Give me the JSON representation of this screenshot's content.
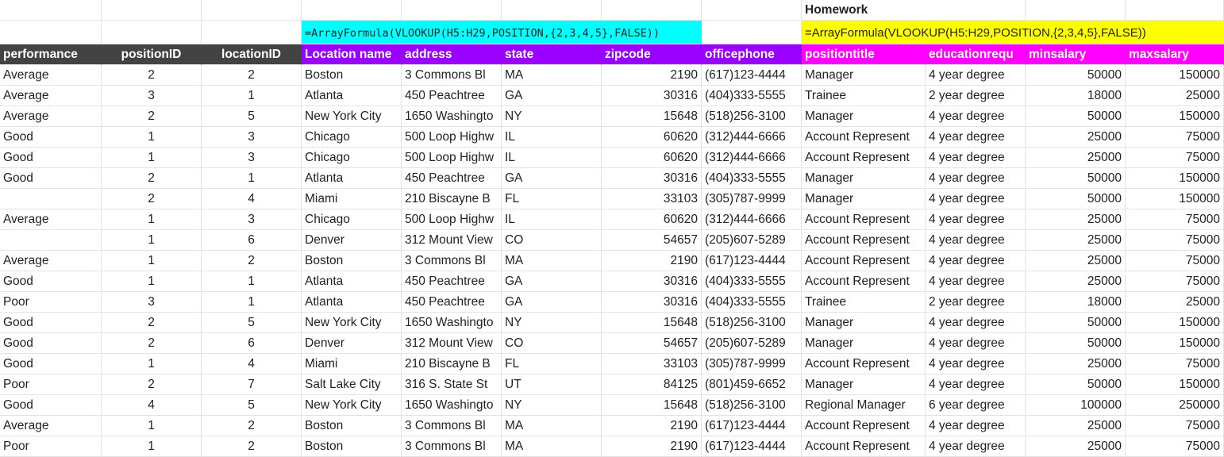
{
  "sheet": {
    "title_cell": "Homework",
    "formula_1": "=ArrayFormula(VLOOKUP(H5:H29,POSITION,{2,3,4,5},FALSE))",
    "formula_2": "=ArrayFormula(VLOOKUP(H5:H29,POSITION,{2,3,4,5},FALSE))",
    "colors": {
      "header_dark": "#434343",
      "header_purple": "#9900ff",
      "header_magenta": "#ff00ff",
      "formula_cyan": "#00ffff",
      "formula_yellow": "#ffff00"
    },
    "headers": [
      "performance",
      "positionID",
      "locationID",
      "Location name",
      "address",
      "state",
      "zipcode",
      "officephone",
      "positiontitle",
      "educationrequ",
      "minsalary",
      "maxsalary"
    ],
    "rows": [
      [
        "Average",
        "2",
        "2",
        "Boston",
        "3 Commons Bl",
        "MA",
        "2190",
        "(617)123-4444",
        "Manager",
        "4 year degree",
        "50000",
        "150000"
      ],
      [
        "Average",
        "3",
        "1",
        "Atlanta",
        "450 Peachtree",
        "GA",
        "30316",
        "(404)333-5555",
        "Trainee",
        "2 year degree",
        "18000",
        "25000"
      ],
      [
        "Average",
        "2",
        "5",
        "New York City",
        "1650 Washingto",
        "NY",
        "15648",
        "(518)256-3100",
        "Manager",
        "4 year degree",
        "50000",
        "150000"
      ],
      [
        "Good",
        "1",
        "3",
        "Chicago",
        "500 Loop Highw",
        "IL",
        "60620",
        "(312)444-6666",
        "Account Represent",
        "4 year degree",
        "25000",
        "75000"
      ],
      [
        "Good",
        "1",
        "3",
        "Chicago",
        "500 Loop Highw",
        "IL",
        "60620",
        "(312)444-6666",
        "Account Represent",
        "4 year degree",
        "25000",
        "75000"
      ],
      [
        "Good",
        "2",
        "1",
        "Atlanta",
        "450 Peachtree",
        "GA",
        "30316",
        "(404)333-5555",
        "Manager",
        "4 year degree",
        "50000",
        "150000"
      ],
      [
        "",
        "2",
        "4",
        "Miami",
        "210 Biscayne B",
        "FL",
        "33103",
        "(305)787-9999",
        "Manager",
        "4 year degree",
        "50000",
        "150000"
      ],
      [
        "Average",
        "1",
        "3",
        "Chicago",
        "500 Loop Highw",
        "IL",
        "60620",
        "(312)444-6666",
        "Account Represent",
        "4 year degree",
        "25000",
        "75000"
      ],
      [
        "",
        "1",
        "6",
        "Denver",
        "312 Mount View",
        "CO",
        "54657",
        "(205)607-5289",
        "Account Represent",
        "4 year degree",
        "25000",
        "75000"
      ],
      [
        "Average",
        "1",
        "2",
        "Boston",
        "3 Commons Bl",
        "MA",
        "2190",
        "(617)123-4444",
        "Account Represent",
        "4 year degree",
        "25000",
        "75000"
      ],
      [
        "Good",
        "1",
        "1",
        "Atlanta",
        "450 Peachtree",
        "GA",
        "30316",
        "(404)333-5555",
        "Account Represent",
        "4 year degree",
        "25000",
        "75000"
      ],
      [
        "Poor",
        "3",
        "1",
        "Atlanta",
        "450 Peachtree",
        "GA",
        "30316",
        "(404)333-5555",
        "Trainee",
        "2 year degree",
        "18000",
        "25000"
      ],
      [
        "Good",
        "2",
        "5",
        "New York City",
        "1650 Washingto",
        "NY",
        "15648",
        "(518)256-3100",
        "Manager",
        "4 year degree",
        "50000",
        "150000"
      ],
      [
        "Good",
        "2",
        "6",
        "Denver",
        "312 Mount View",
        "CO",
        "54657",
        "(205)607-5289",
        "Manager",
        "4 year degree",
        "50000",
        "150000"
      ],
      [
        "Good",
        "1",
        "4",
        "Miami",
        "210 Biscayne B",
        "FL",
        "33103",
        "(305)787-9999",
        "Account Represent",
        "4 year degree",
        "25000",
        "75000"
      ],
      [
        "Poor",
        "2",
        "7",
        "Salt Lake City",
        "316 S. State St",
        "UT",
        "84125",
        "(801)459-6652",
        "Manager",
        "4 year degree",
        "50000",
        "150000"
      ],
      [
        "Good",
        "4",
        "5",
        "New York City",
        "1650 Washingto",
        "NY",
        "15648",
        "(518)256-3100",
        "Regional Manager",
        "6 year degree",
        "100000",
        "250000"
      ],
      [
        "Average",
        "1",
        "2",
        "Boston",
        "3 Commons Bl",
        "MA",
        "2190",
        "(617)123-4444",
        "Account Represent",
        "4 year degree",
        "25000",
        "75000"
      ],
      [
        "Poor",
        "1",
        "2",
        "Boston",
        "3 Commons Bl",
        "MA",
        "2190",
        "(617)123-4444",
        "Account Represent",
        "4 year degree",
        "25000",
        "75000"
      ]
    ]
  }
}
